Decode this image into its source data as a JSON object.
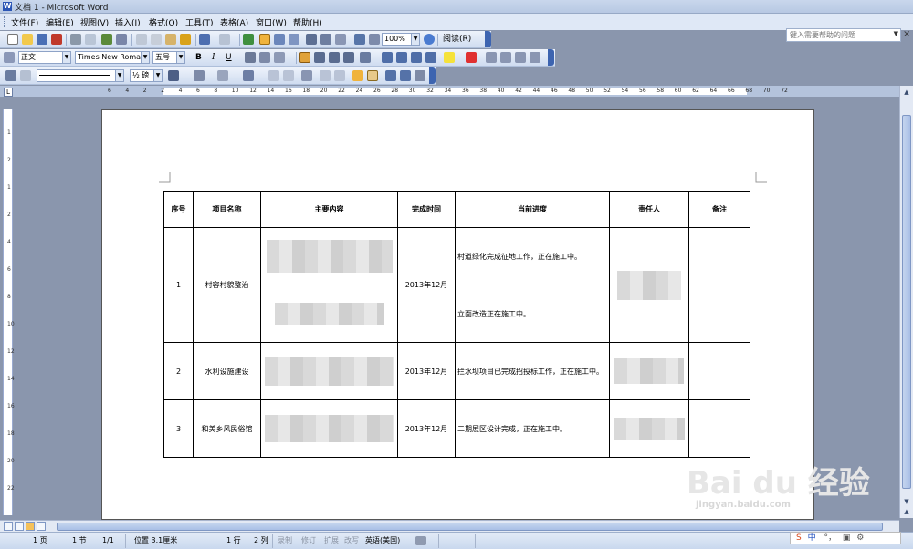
{
  "window": {
    "title": "文档 1 - Microsoft Word"
  },
  "menu": {
    "items": [
      "文件(F)",
      "编辑(E)",
      "视图(V)",
      "插入(I)",
      "格式(O)",
      "工具(T)",
      "表格(A)",
      "窗口(W)",
      "帮助(H)"
    ],
    "help_placeholder": "键入需要帮助的问题",
    "close": "×"
  },
  "toolbar": {
    "zoom": "100%",
    "read_mode": "阅读(R)",
    "style": "正文",
    "font": "Times New Roman",
    "size": "五号",
    "bold": "B",
    "italic": "I",
    "underline": "U",
    "line_weight": "½ 磅"
  },
  "ruler": {
    "marks": [
      "6",
      "4",
      "2",
      "2",
      "4",
      "6",
      "8",
      "10",
      "12",
      "14",
      "16",
      "18",
      "20",
      "22",
      "24",
      "26",
      "28",
      "30",
      "32",
      "34",
      "36",
      "38",
      "40",
      "42",
      "44",
      "46",
      "48",
      "50",
      "52",
      "54",
      "56",
      "58",
      "60",
      "62",
      "64",
      "66",
      "68",
      "70",
      "72"
    ],
    "vmarks": [
      "1",
      "2",
      "1",
      "2",
      "4",
      "6",
      "8",
      "10",
      "12",
      "14",
      "16",
      "18",
      "20",
      "22"
    ]
  },
  "table": {
    "headers": [
      "序号",
      "项目名称",
      "主要内容",
      "完成时间",
      "当前进度",
      "责任人",
      "备注"
    ],
    "rows": [
      {
        "no": "1",
        "name": "村容村貌整治",
        "time": "2013年12月",
        "progress_a": "村道绿化完成征地工作，正在施工中。",
        "progress_b": "立面改造正在施工中。"
      },
      {
        "no": "2",
        "name": "水利设施建设",
        "time": "2013年12月",
        "progress": "拦水坝项目已完成招投标工作，正在施工中。"
      },
      {
        "no": "3",
        "name": "和美乡风民俗馆",
        "time": "2013年12月",
        "progress": "二期展区设计完成，正在施工中。"
      }
    ]
  },
  "status": {
    "page": "1 页",
    "section": "1 节",
    "pages": "1/1",
    "position": "位置 3.1厘米",
    "line": "1 行",
    "col": "2 列",
    "rec": "录制",
    "trk": "修订",
    "ext": "扩展",
    "ovr": "改写",
    "lang": "英语(美国)"
  },
  "ime": {
    "label": "中"
  },
  "watermark": {
    "text": "Bai du 经验",
    "sub": "jingyan.baidu.com"
  }
}
